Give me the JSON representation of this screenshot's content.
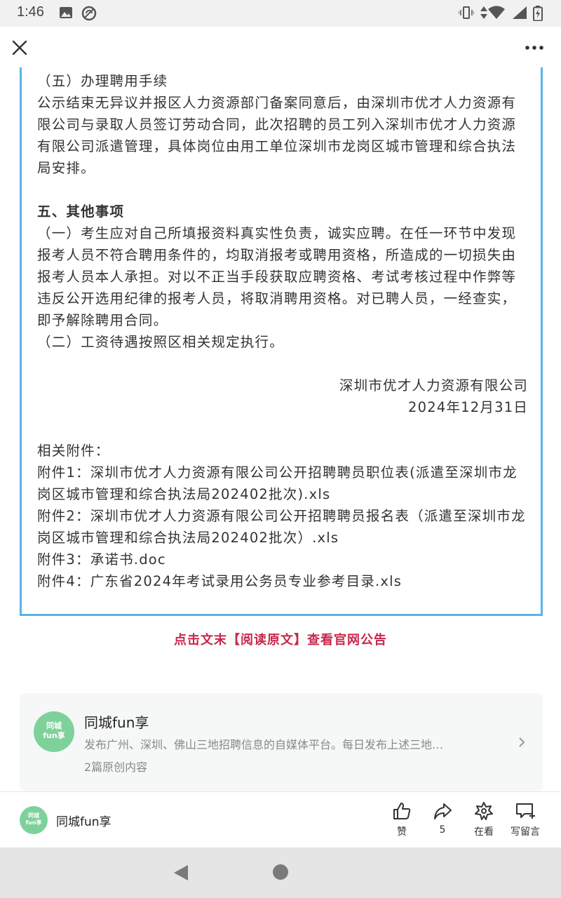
{
  "status_bar": {
    "time": "1:46",
    "icons": [
      "image-icon",
      "sync-icon",
      "vibrate-icon",
      "data-arrows-icon",
      "wifi-icon",
      "signal-icon",
      "battery-charging-icon"
    ]
  },
  "top_nav": {
    "close_icon": "close-icon",
    "more_icon": "more-icon"
  },
  "article": {
    "section_5_heading": "（五）办理聘用手续",
    "section_5_body": "公示结束无异议并报区人力资源部门备案同意后，由深圳市优才人力资源有限公司与录取人员签订劳动合同，此次招聘的员工列入深圳市优才人力资源有限公司派遣管理，具体岗位由用工单位深圳市龙岗区城市管理和综合执法局安排。",
    "other_heading": "五、其他事项",
    "other_item_1": "（一）考生应对自己所填报资料真实性负责，诚实应聘。在任一环节中发现报考人员不符合聘用条件的，均取消报考或聘用资格，所造成的一切损失由报考人员本人承担。对以不正当手段获取应聘资格、考试考核过程中作弊等违反公开选用纪律的报考人员，将取消聘用资格。对已聘人员，一经查实，即予解除聘用合同。",
    "other_item_2": "（二）工资待遇按照区相关规定执行。",
    "signature_org": "深圳市优才人力资源有限公司",
    "signature_date": "2024年12月31日",
    "attachments_title": "相关附件：",
    "attachments": [
      "附件1：深圳市优才人力资源有限公司公开招聘聘员职位表(派遣至深圳市龙岗区城市管理和综合执法局202402批次).xls",
      "附件2：深圳市优才人力资源有限公司公开招聘聘员报名表（派遣至深圳市龙岗区城市管理和综合执法局202402批次）.xls",
      "附件3：承诺书.doc",
      "附件4：广东省2024年考试录用公务员专业参考目录.xls"
    ]
  },
  "read_original": "点击文末【阅读原文】查看官网公告",
  "account_card": {
    "avatar_text_1": "同城",
    "avatar_text_2": "fun享",
    "name": "同城fun享",
    "description": "发布广州、深圳、佛山三地招聘信息的自媒体平台。每日发布上述三地…",
    "count": "2篇原创内容"
  },
  "bottom_bar": {
    "avatar_text_1": "同城",
    "avatar_text_2": "fun享",
    "name": "同城fun享",
    "like_label": "赞",
    "share_count": "5",
    "wow_label": "在看",
    "comment_label": "写留言"
  },
  "colors": {
    "border_accent": "#5ab4e6",
    "link_red": "#c8284a",
    "avatar_green": "#7fd19c"
  }
}
